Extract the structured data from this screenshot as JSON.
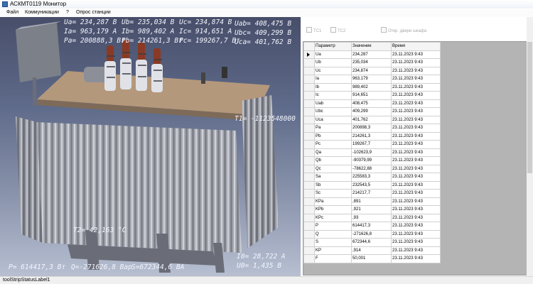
{
  "window": {
    "title": "АСКМТ0119 Монитор"
  },
  "menu": [
    "Файл",
    "Коммуникации",
    "?",
    "Опрос станции"
  ],
  "scene": {
    "readouts": [
      {
        "id": "ua",
        "text": "Ua= 234,287 В"
      },
      {
        "id": "ub",
        "text": "Ub= 235,034 В"
      },
      {
        "id": "uc",
        "text": "Uc= 234,874 В"
      },
      {
        "id": "ia",
        "text": "Ia= 963,179 A"
      },
      {
        "id": "ib",
        "text": "Ib= 989,402 A"
      },
      {
        "id": "ic",
        "text": "Ic= 914,651 A"
      },
      {
        "id": "pa",
        "text": "Pa= 200888,3 Вт"
      },
      {
        "id": "pb",
        "text": "Pb= 214261,3 Вт"
      },
      {
        "id": "pc",
        "text": "Pc= 199267,7 Вт"
      },
      {
        "id": "uab",
        "text": "Uab= 408,475 В"
      },
      {
        "id": "ubc",
        "text": "Ubc= 409,299 В"
      },
      {
        "id": "uca",
        "text": "Uca= 401,762 В"
      },
      {
        "id": "t1",
        "text": "T1= -1123548000"
      },
      {
        "id": "t2",
        "text": "T2= 42,163 °C"
      },
      {
        "id": "i0",
        "text": "I0= 28,722 A"
      },
      {
        "id": "u0",
        "text": "U0= 1,435 В"
      },
      {
        "id": "p",
        "text": "P= 614417,3 Вт"
      },
      {
        "id": "q",
        "text": "Q=-271626,8 Вар"
      },
      {
        "id": "s",
        "text": "S=672344,6 ВА"
      }
    ]
  },
  "checkboxes": [
    {
      "label": "TC1"
    },
    {
      "label": "TC2"
    },
    {
      "label": "Откр. двери шкафа"
    }
  ],
  "table": {
    "headers": [
      "Параметр",
      "Значение",
      "Время"
    ],
    "rows": [
      [
        "Ua",
        "234,287",
        "23.11.2023 9:43"
      ],
      [
        "Ub",
        "235,034",
        "23.11.2023 9:43"
      ],
      [
        "Uc",
        "234,874",
        "23.11.2023 9:43"
      ],
      [
        "Ia",
        "963,179",
        "23.11.2023 9:43"
      ],
      [
        "Ib",
        "989,402",
        "23.11.2023 9:43"
      ],
      [
        "Ic",
        "914,651",
        "23.11.2023 9:43"
      ],
      [
        "Uab",
        "408,475",
        "23.11.2023 9:43"
      ],
      [
        "Ubc",
        "409,299",
        "23.11.2023 9:43"
      ],
      [
        "Uca",
        "401,762",
        "23.11.2023 9:43"
      ],
      [
        "Pa",
        "200898,3",
        "23.11.2023 9:43"
      ],
      [
        "Pb",
        "214261,3",
        "23.11.2023 9:43"
      ],
      [
        "Pc",
        "199267,7",
        "23.11.2023 9:43"
      ],
      [
        "Qa",
        "-102623,9",
        "23.11.2023 9:43"
      ],
      [
        "Qb",
        "-90379,99",
        "23.11.2023 9:43"
      ],
      [
        "Qc",
        "-78622,88",
        "23.11.2023 9:43"
      ],
      [
        "Sa",
        "225583,3",
        "23.11.2023 9:43"
      ],
      [
        "Sb",
        "232543,5",
        "23.11.2023 9:43"
      ],
      [
        "Sc",
        "214217,7",
        "23.11.2023 9:43"
      ],
      [
        "KPa",
        ",891",
        "23.11.2023 9:43"
      ],
      [
        "KPb",
        ",921",
        "23.11.2023 9:43"
      ],
      [
        "KPc",
        ",93",
        "23.11.2023 9:43"
      ],
      [
        "P",
        "614417,3",
        "23.11.2023 9:43"
      ],
      [
        "Q",
        "-271626,8",
        "23.11.2023 9:43"
      ],
      [
        "S",
        "672344,6",
        "23.11.2023 9:43"
      ],
      [
        "KP",
        ",914",
        "23.11.2023 9:43"
      ],
      [
        "F",
        "50,001",
        "23.11.2023 9:43"
      ]
    ]
  },
  "status": {
    "label": "toolStripStatusLabel1"
  },
  "colors": {
    "scene_top": "#474e6a",
    "scene_bottom": "#b7bfd1",
    "readout": "#f4f6ff"
  },
  "icons": {
    "window": "app-icon",
    "row_current": "row-pointer-icon"
  }
}
